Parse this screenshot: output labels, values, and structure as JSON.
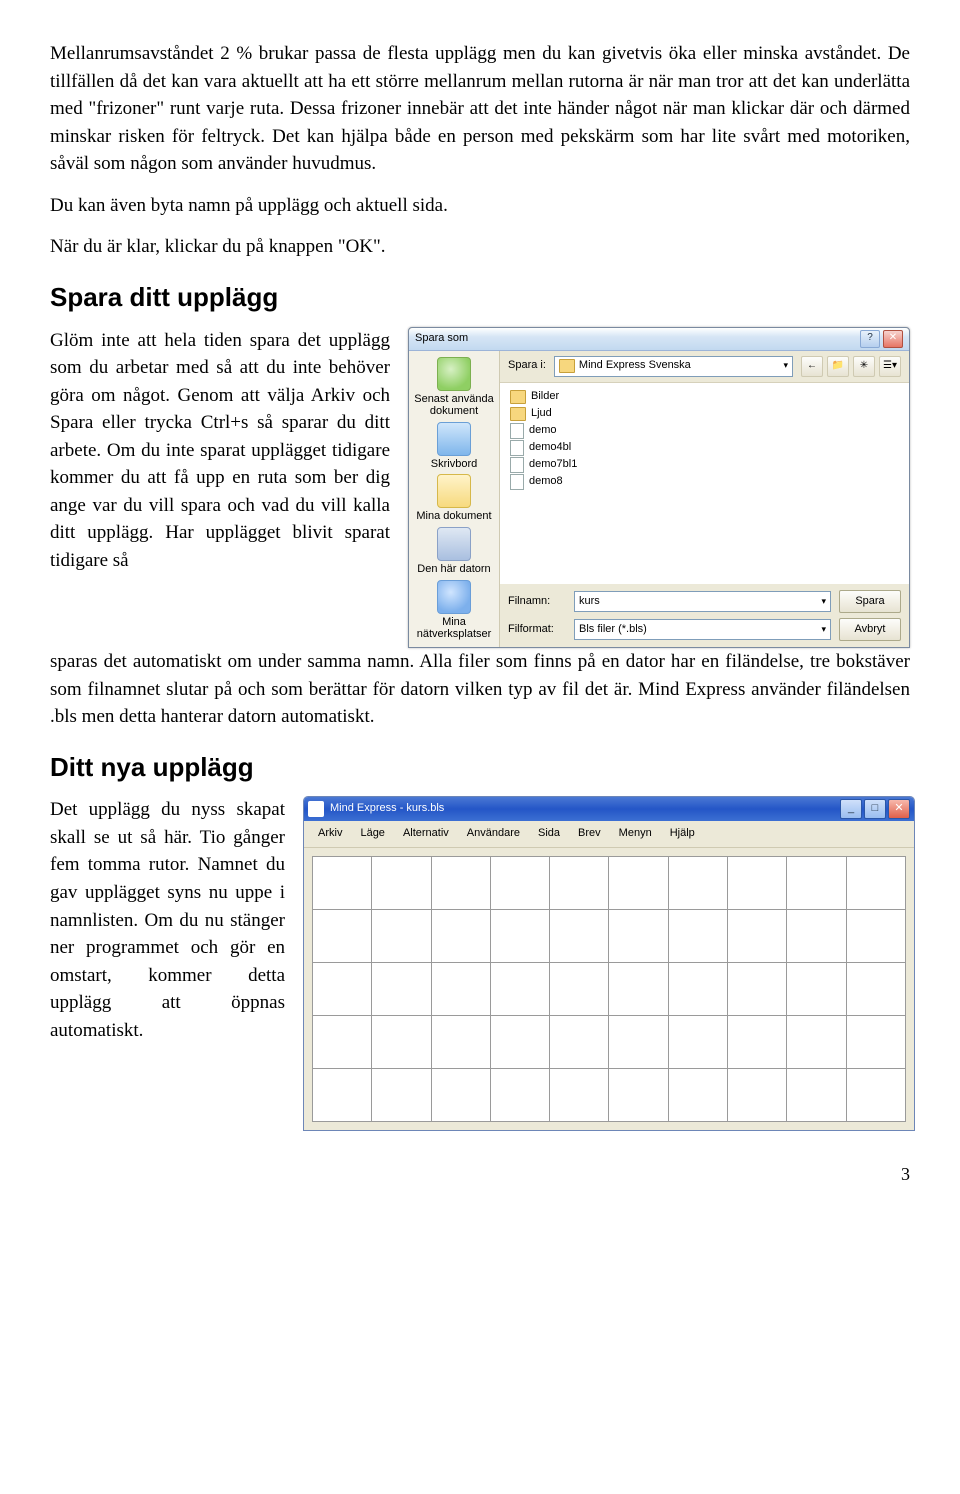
{
  "paragraphs": {
    "p1": "Mellanrumsavståndet 2 % brukar passa de flesta upplägg men du kan givetvis öka eller minska avståndet. De tillfällen då det kan vara aktuellt att ha ett större mellanrum mellan rutorna är när man tror att det kan underlätta med \"frizoner\" runt varje ruta. Dessa frizoner innebär att det inte händer något när man klickar där och därmed minskar risken för feltryck. Det kan hjälpa både en person med pekskärm som har lite svårt med motoriken, såväl som någon som använder huvudmus.",
    "p2": "Du kan även byta namn på upplägg och aktuell sida.",
    "p3": "När du är klar, klickar du på knappen \"OK\".",
    "spara_body_a": "Glöm inte att hela tiden spara det upplägg som du arbetar med så att du inte behöver göra om något. Genom att välja Arkiv och Spara eller trycka Ctrl+s så sparar du ditt arbete. Om du inte sparat upplägget tidigare kommer du att få upp en ruta som ber dig ange var du vill spara och vad du vill kalla ditt upplägg. Har upplägget blivit sparat tidigare så",
    "spara_body_b": "sparas det automatiskt om under samma namn. Alla filer som finns på en dator har en filändelse, tre bokstäver som filnamnet slutar på och som berättar för datorn vilken typ av fil det är. Mind Express använder filändelsen .bls men detta hanterar datorn automatiskt.",
    "nya_body": "Det upplägg du nyss skapat skall se ut så här. Tio gånger fem tomma rutor. Namnet du gav upplägget syns nu uppe i namnlisten. Om du nu stänger ner programmet och gör en omstart, kommer detta upplägg att öppnas automatiskt."
  },
  "headings": {
    "h_spara": "Spara ditt upplägg",
    "h_nya": "Ditt nya upplägg"
  },
  "save_dialog": {
    "title": "Spara som",
    "save_in_label": "Spara i:",
    "save_in_value": "Mind Express Svenska",
    "places": {
      "recent": "Senast använda dokument",
      "desktop": "Skrivbord",
      "mydocs": "Mina dokument",
      "mycomp": "Den här datorn",
      "network": "Mina nätverksplatser"
    },
    "files": {
      "f0": "Bilder",
      "f1": "Ljud",
      "f2": "demo",
      "f3": "demo4bl",
      "f4": "demo7bl1",
      "f5": "demo8"
    },
    "filename_label": "Filnamn:",
    "filename_value": "kurs",
    "format_label": "Filformat:",
    "format_value": "Bls filer (*.bls)",
    "btn_save": "Spara",
    "btn_cancel": "Avbryt"
  },
  "app_window": {
    "title": "Mind Express - kurs.bls",
    "menu": {
      "m0": "Arkiv",
      "m1": "Läge",
      "m2": "Alternativ",
      "m3": "Användare",
      "m4": "Sida",
      "m5": "Brev",
      "m6": "Menyn",
      "m7": "Hjälp"
    }
  },
  "page_number": "3"
}
